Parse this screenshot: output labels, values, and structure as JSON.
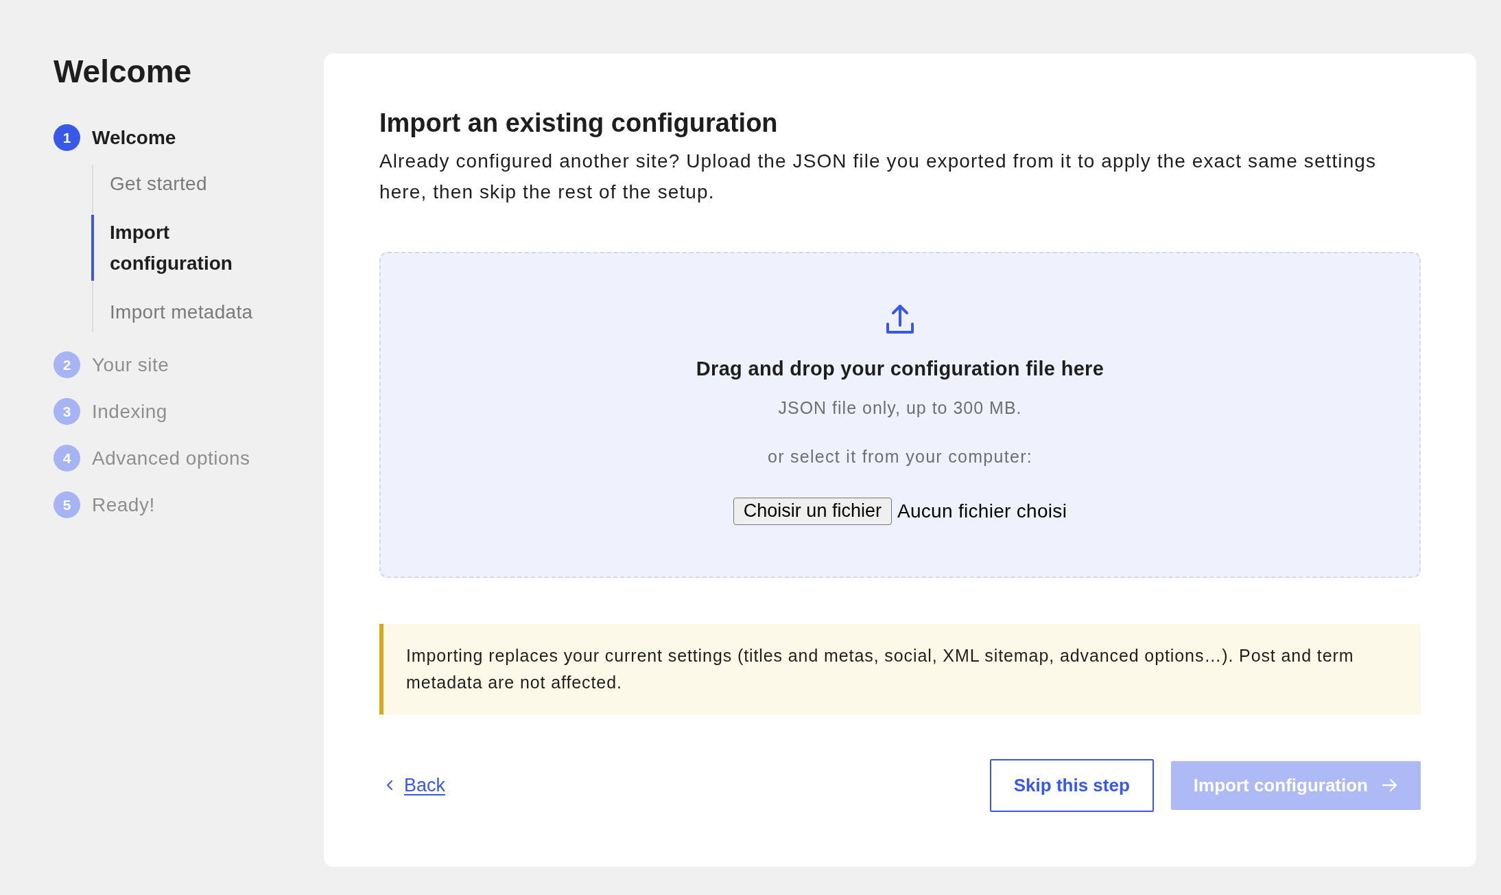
{
  "sidebar": {
    "title": "Welcome",
    "steps": [
      {
        "number": "1",
        "label": "Welcome",
        "selected": true,
        "children": [
          {
            "label": "Get started",
            "selected": false
          },
          {
            "label": "Import configuration",
            "selected": true
          },
          {
            "label": "Import metadata",
            "selected": false
          }
        ]
      },
      {
        "number": "2",
        "label": "Your site",
        "selected": false
      },
      {
        "number": "3",
        "label": "Indexing",
        "selected": false
      },
      {
        "number": "4",
        "label": "Advanced options",
        "selected": false
      },
      {
        "number": "5",
        "label": "Ready!",
        "selected": false
      }
    ]
  },
  "main": {
    "title": "Import an existing configuration",
    "description": "Already configured another site? Upload the JSON file you exported from it to apply the exact same settings here, then skip the rest of the setup.",
    "dropzone": {
      "title": "Drag and drop your configuration file here",
      "hint": "JSON file only, up to 300 MB.",
      "alternative": "or select it from your computer:",
      "file_button": "Choisir un fichier",
      "file_status": "Aucun fichier choisi"
    },
    "notice": "Importing replaces your current settings (titles and metas, social, XML sitemap, advanced options…). Post and term metadata are not affected.",
    "back_link": "Back",
    "skip_button": "Skip this step",
    "import_button": {
      "label": "Import configuration",
      "disabled": true
    }
  }
}
